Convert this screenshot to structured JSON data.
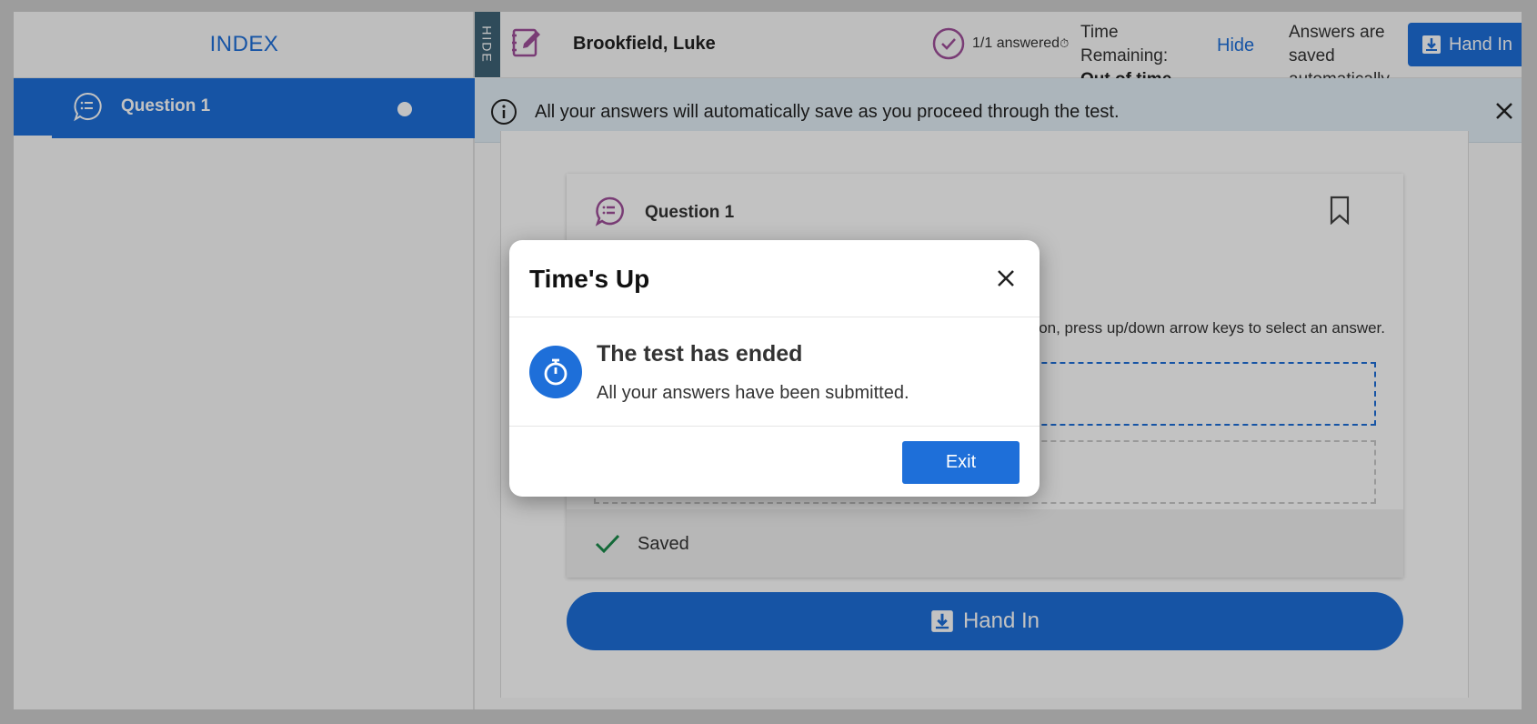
{
  "sidebar": {
    "title": "INDEX",
    "items": [
      {
        "label": "Question 1"
      }
    ],
    "hide_tab": "HIDE"
  },
  "header": {
    "user_name": "Brookfield, Luke",
    "answered": "1/1 answered",
    "time_label_line1": "Time",
    "time_label_line2": "Remaining:",
    "time_status": "Out of time",
    "hide_link": "Hide",
    "saved_line1": "Answers are",
    "saved_line2": "saved",
    "saved_line3": "automatically",
    "hand_in": "Hand In"
  },
  "banner": {
    "message": "All your answers will automatically save as you proceed through the test."
  },
  "question": {
    "title": "Question 1",
    "instruction": "tion, press up/down arrow keys to select an answer.",
    "saved": "Saved"
  },
  "footer": {
    "hand_in": "Hand In"
  },
  "modal": {
    "title": "Time's Up",
    "heading": "The test has ended",
    "text": "All your answers have been submitted.",
    "exit": "Exit"
  },
  "colors": {
    "primary": "#1e6fd9",
    "accent_purple": "#a04f9a",
    "success": "#1a8a4a"
  }
}
